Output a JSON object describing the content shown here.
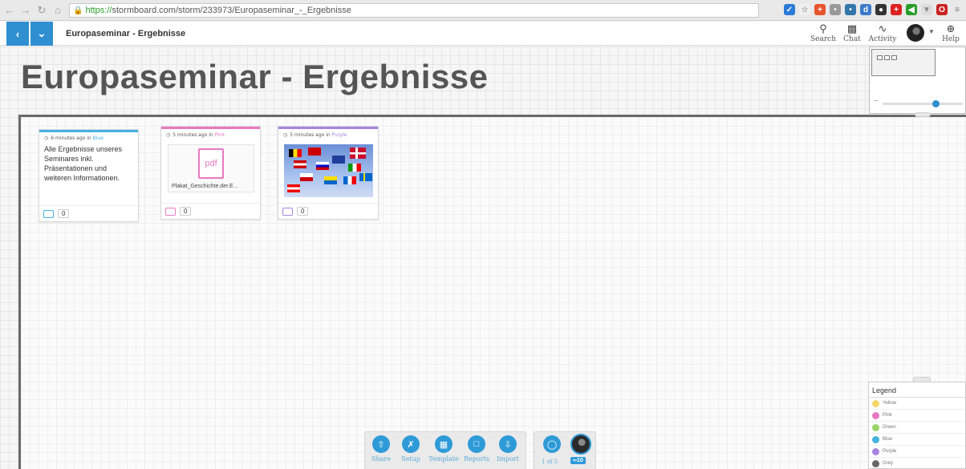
{
  "browser": {
    "url_https": "https://",
    "url_rest": "stormboard.com/storm/233973/Europaseminar_-_Ergebnisse"
  },
  "header": {
    "board_name": "Europaseminar - Ergebnisse",
    "tools": [
      {
        "label": "Search",
        "icon": "search-icon"
      },
      {
        "label": "Chat",
        "icon": "chat-icon"
      },
      {
        "label": "Activity",
        "icon": "activity-icon"
      },
      {
        "label": "Help",
        "icon": "help-icon"
      }
    ]
  },
  "board": {
    "title": "Europaseminar - Ergebnisse"
  },
  "ideas": [
    {
      "time": "6 minutes ago in",
      "color_name": "Blue",
      "color": "#44b3e0",
      "text": "Alle Ergebnisse unseres Seminares inkl. Präsentationen und weiteren Informationen.",
      "comments": "0"
    },
    {
      "time": "5 minutes ago in",
      "color_name": "Pink",
      "color": "#e879c0",
      "file_icon": "pdf",
      "file_name": "Plakat_Geschichte.der.E...",
      "comments": "0"
    },
    {
      "time": "5 minutes ago in",
      "color_name": "Purple",
      "color": "#a785e0",
      "comments": "0"
    }
  ],
  "legend": {
    "title": "Legend",
    "items": [
      {
        "label": "Yellow",
        "color": "#f5d66a"
      },
      {
        "label": "Pink",
        "color": "#e879c0"
      },
      {
        "label": "Green",
        "color": "#9bd36b"
      },
      {
        "label": "Blue",
        "color": "#44b3e0"
      },
      {
        "label": "Purple",
        "color": "#a785e0"
      },
      {
        "label": "Grey",
        "color": "#666666"
      }
    ]
  },
  "toolbar": {
    "items": [
      {
        "label": "Share",
        "icon": "share-icon"
      },
      {
        "label": "Setup",
        "icon": "setup-icon"
      },
      {
        "label": "Template",
        "icon": "template-icon"
      },
      {
        "label": "Reports",
        "icon": "reports-icon"
      },
      {
        "label": "Import",
        "icon": "import-icon"
      }
    ],
    "users_label": "1 of 5",
    "badge": "10"
  }
}
